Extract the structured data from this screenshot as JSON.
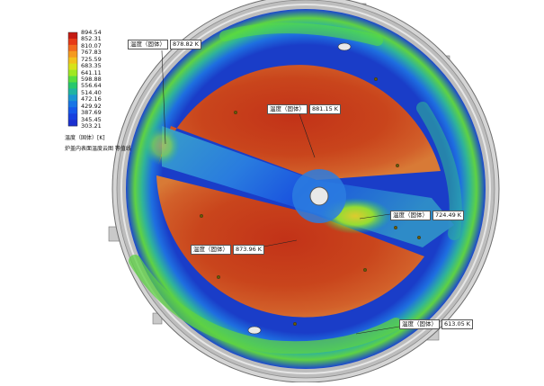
{
  "legend": {
    "values": [
      "894.54",
      "852.31",
      "810.07",
      "767.83",
      "725.59",
      "683.35",
      "641.11",
      "598.88",
      "556.64",
      "514.40",
      "472.16",
      "429.92",
      "387.69",
      "345.45",
      "303.21"
    ],
    "colors": [
      "#c41a12",
      "#e63a17",
      "#f26a1e",
      "#f59a1f",
      "#f2c21c",
      "#d7e31a",
      "#9fe822",
      "#57de3f",
      "#27c86d",
      "#1fb4a1",
      "#1a95d2",
      "#1775e6",
      "#1558ea",
      "#1740df",
      "#1a2fd0"
    ],
    "title": "温度（固体）[K]",
    "caption": "炉盖内表面温度云图 等值线"
  },
  "probes": [
    {
      "label": "温度（固体）",
      "value": "878.82 K"
    },
    {
      "label": "温度（固体）",
      "value": "881.15 K"
    },
    {
      "label": "温度（固体）",
      "value": "724.49 K"
    },
    {
      "label": "温度（固体）",
      "value": "873.96 K"
    },
    {
      "label": "温度（固体）",
      "value": "613.05 K"
    }
  ],
  "colors": {
    "hot": "#c8461d",
    "hot_dark": "#b9351a",
    "warm": "#e9b21c",
    "green": "#5ed244",
    "teal": "#2fb39a",
    "blue": "#1e5ed8",
    "deep_blue": "#1a3dc8",
    "rim": "#b8b8b8",
    "rim_dark": "#6e6e6e"
  }
}
